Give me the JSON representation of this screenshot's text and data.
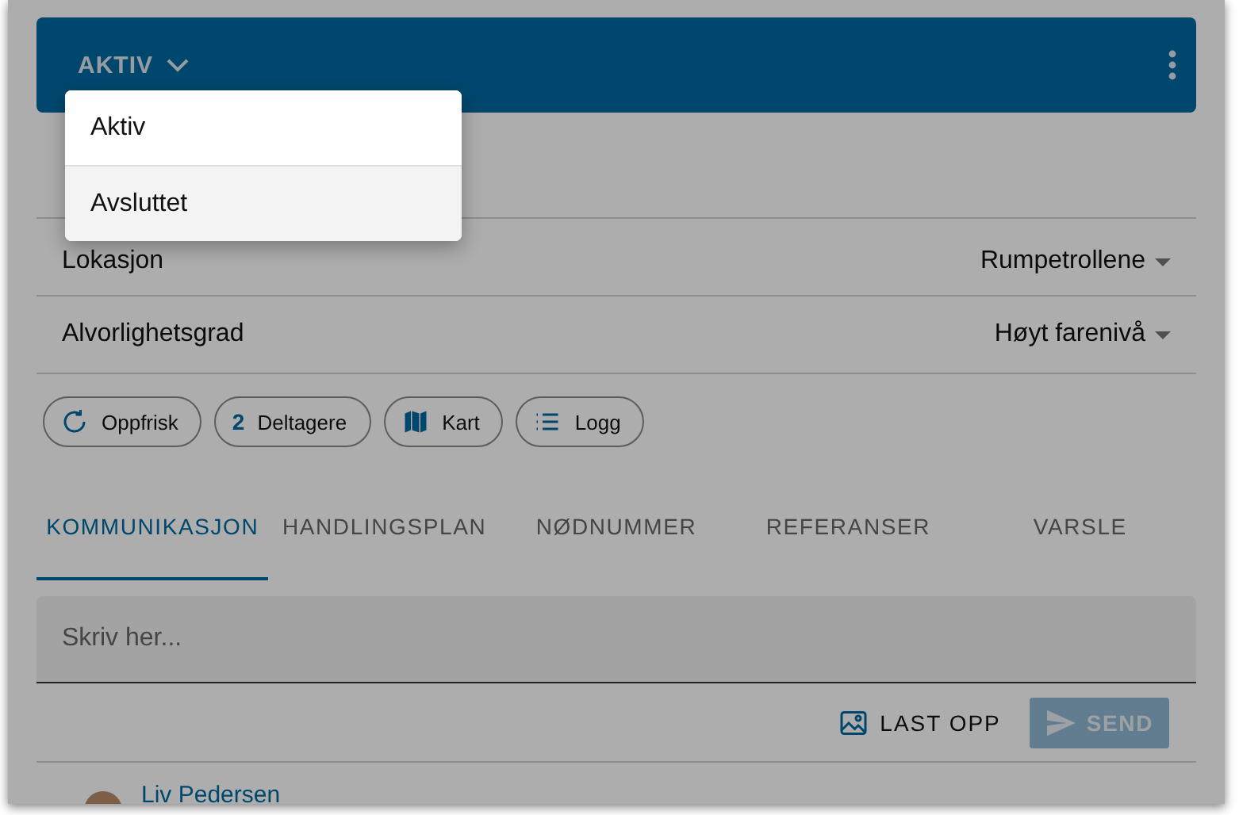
{
  "header": {
    "status": "AKTIV"
  },
  "status_menu": {
    "items": [
      {
        "label": "Aktiv",
        "highlighted": false
      },
      {
        "label": "Avsluttet",
        "highlighted": true
      }
    ]
  },
  "fields": [
    {
      "label": "Lokasjon",
      "value": "Rumpetrollene"
    },
    {
      "label": "Alvorlighetsgrad",
      "value": "Høyt farenivå"
    }
  ],
  "chips": [
    {
      "kind": "refresh",
      "label": "Oppfrisk"
    },
    {
      "kind": "count",
      "count": "2",
      "label": "Deltagere"
    },
    {
      "kind": "map",
      "label": "Kart"
    },
    {
      "kind": "list",
      "label": "Logg"
    }
  ],
  "tabs": [
    {
      "label": "KOMMUNIKASJON",
      "selected": true
    },
    {
      "label": "HANDLINGSPLAN",
      "selected": false
    },
    {
      "label": "NØDNUMMER",
      "selected": false
    },
    {
      "label": "REFERANSER",
      "selected": false
    },
    {
      "label": "VARSLE",
      "selected": false
    }
  ],
  "message": {
    "placeholder": "Skriv her...",
    "upload": "LAST OPP",
    "send": "SEND",
    "send_disabled": true
  },
  "messages": [
    {
      "author": "Liv Pedersen"
    }
  ]
}
